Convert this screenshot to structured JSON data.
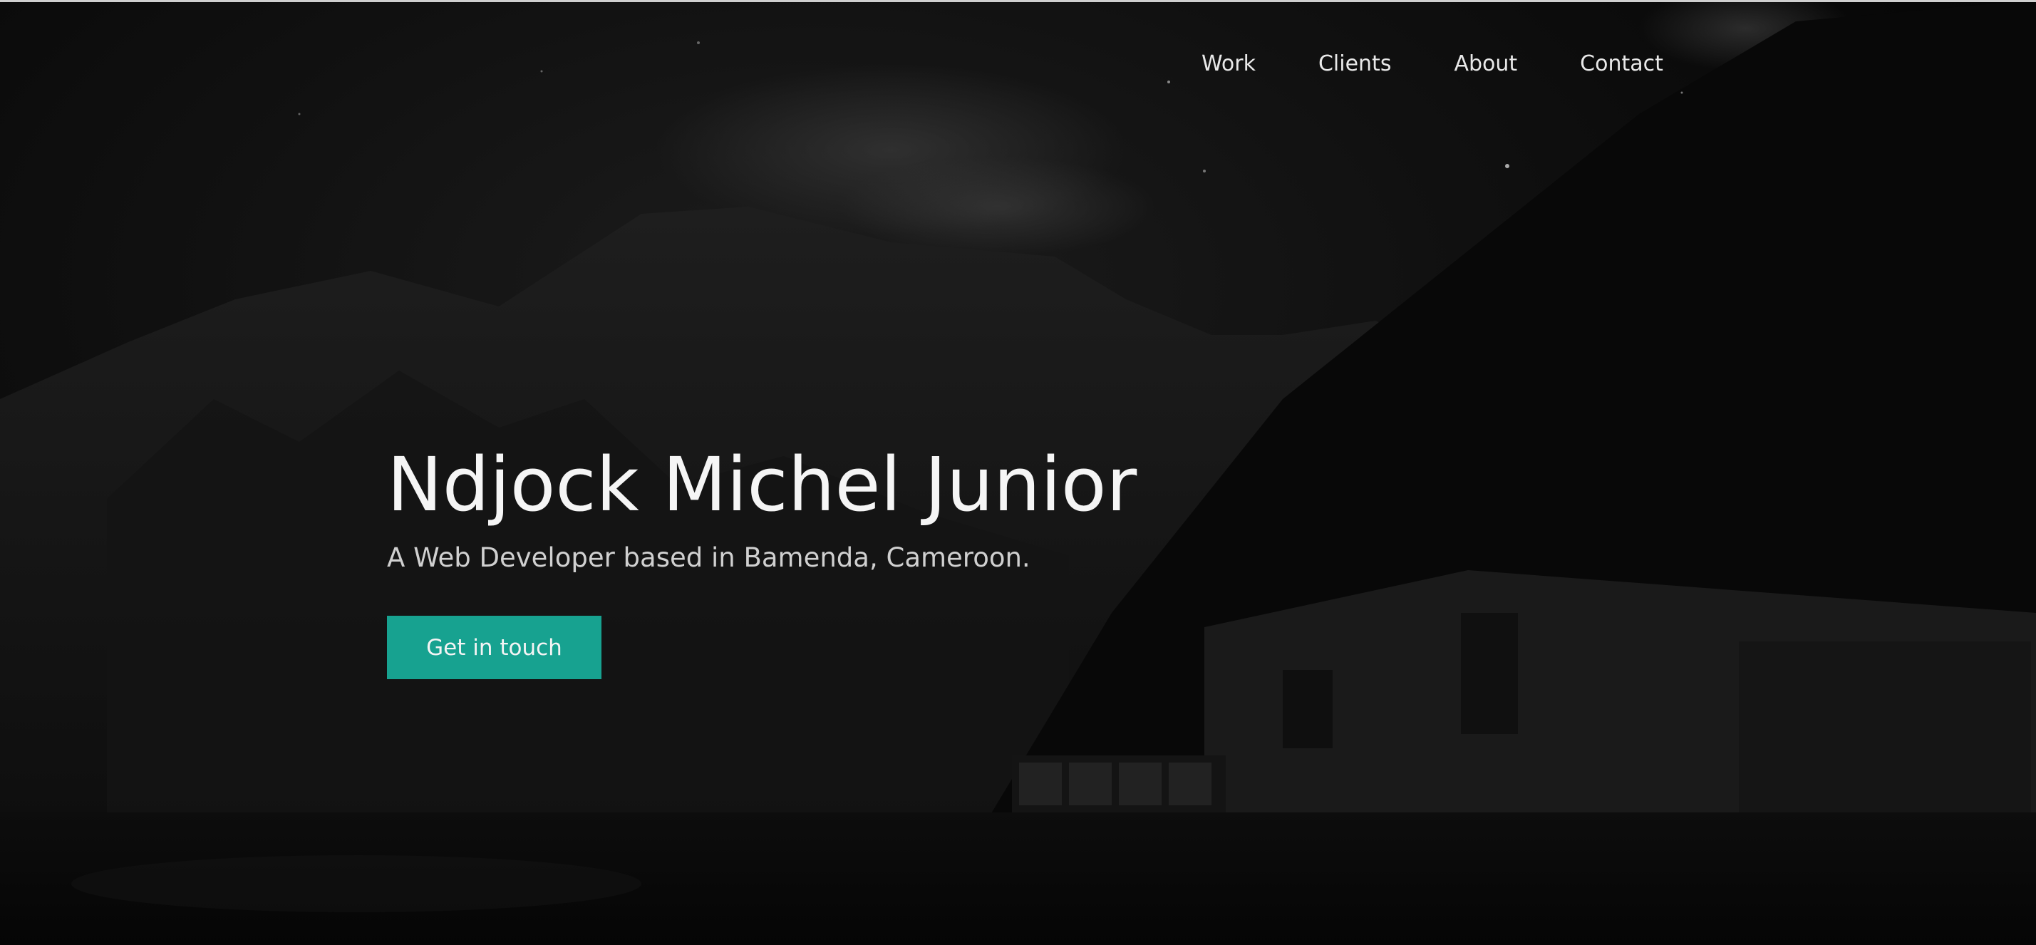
{
  "nav": {
    "items": [
      {
        "label": "Work"
      },
      {
        "label": "Clients"
      },
      {
        "label": "About"
      },
      {
        "label": "Contact"
      }
    ]
  },
  "hero": {
    "name": "Ndjock Michel Junior",
    "tagline": "A Web Developer based in Bamenda, Cameroon.",
    "cta_label": "Get in touch",
    "background": "night-mountain-lake-cabin-image"
  },
  "colors": {
    "accent": "#17a290",
    "background": "#050505",
    "text": "#f5f5f5"
  }
}
